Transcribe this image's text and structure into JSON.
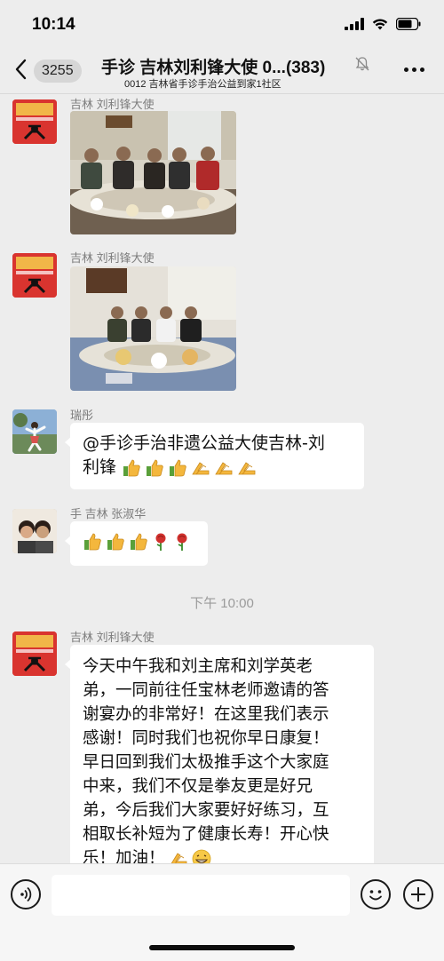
{
  "status_bar": {
    "time": "10:14"
  },
  "header": {
    "unread_count": "3255",
    "title": "手诊 吉林刘利锋大使 0...(383)",
    "subtitle": "0012 吉林省手诊手治公益到家1社区"
  },
  "messages": [
    {
      "sender": "吉林 刘利锋大使",
      "type": "image",
      "alt": "group-dinner-photo"
    },
    {
      "sender": "吉林 刘利锋大使",
      "type": "image",
      "alt": "group-dinner-photo-2"
    },
    {
      "sender": "瑞彤",
      "type": "text",
      "line1": "@手诊手治非遗公益大使吉林-刘",
      "line2": "利锋"
    },
    {
      "sender": "手 吉林 张淑华",
      "type": "text"
    },
    {
      "sender": "吉林 刘利锋大使",
      "type": "text",
      "lines": [
        "今天中午我和刘主席和刘学英老",
        "弟，一同前往任宝林老师邀请的答",
        "谢宴办的非常好！在这里我们表示",
        "感谢！同时我们也祝你早日康复！",
        "早日回到我们太极推手这个大家庭",
        "中来，我们不仅是拳友更是好兄",
        "弟，今后我们大家要好好练习，互",
        "相取长补短为了健康长寿！开心快",
        "乐！加油！"
      ]
    }
  ],
  "timestamp": "下午 10:00",
  "colors": {
    "background": "#ededed",
    "bubble": "#ffffff",
    "sender": "#7d7d7d",
    "timestamp": "#9b9b9b"
  }
}
